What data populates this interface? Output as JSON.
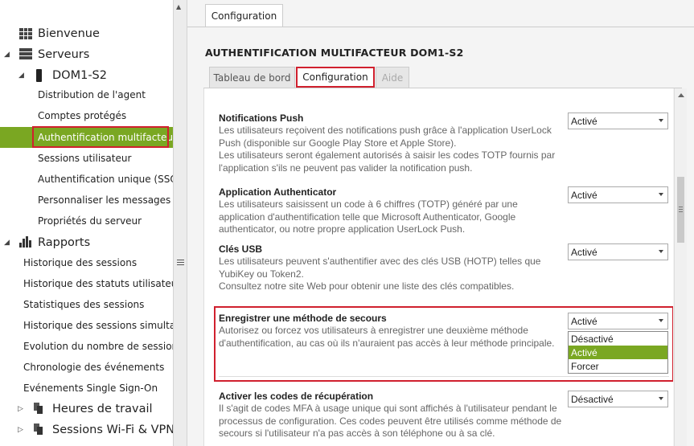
{
  "sidebar": {
    "items": [
      {
        "label": "Bienvenue",
        "icon": "grid-icon"
      },
      {
        "label": "Serveurs",
        "icon": "servers-icon"
      },
      {
        "label": "DOM1-S2",
        "icon": "server-tower-icon"
      },
      {
        "label": "Distribution de l'agent"
      },
      {
        "label": "Comptes protégés"
      },
      {
        "label": "Authentification multifacteur",
        "selected": true
      },
      {
        "label": "Sessions utilisateur"
      },
      {
        "label": "Authentification unique (SSO)"
      },
      {
        "label": "Personnaliser les messages"
      },
      {
        "label": "Propriétés du serveur"
      },
      {
        "label": "Rapports",
        "icon": "bar-chart-icon"
      },
      {
        "label": "Historique des sessions"
      },
      {
        "label": "Historique des statuts utilisateur"
      },
      {
        "label": "Statistiques des sessions"
      },
      {
        "label": "Historique des sessions simultan..."
      },
      {
        "label": "Evolution du nombre de sessions"
      },
      {
        "label": "Chronologie des événements"
      },
      {
        "label": "Evénements Single Sign-On"
      },
      {
        "label": "Heures de travail",
        "icon": "documents-icon"
      },
      {
        "label": "Sessions Wi-Fi & VPN",
        "icon": "documents-icon"
      }
    ]
  },
  "main": {
    "top_tab": "Configuration",
    "page_title": "AUTHENTIFICATION MULTIFACTEUR  DOM1-S2",
    "subtabs": [
      "Tableau de bord",
      "Configuration",
      "Aide"
    ],
    "settings": [
      {
        "title": "Notifications Push",
        "desc": "Les utilisateurs reçoivent des notifications push grâce à l'application UserLock Push (disponible sur Google Play Store et Apple Store).\nLes utilisateurs seront également autorisés à saisir les codes TOTP fournis par l'application s'ils ne peuvent pas valider la notification push.",
        "value": "Activé"
      },
      {
        "title": "Application Authenticator",
        "desc": "Les utilisateurs saisissent un code à 6 chiffres (TOTP) généré par une application d'authentification telle que Microsoft Authenticator, Google authenticator, ou notre propre application UserLock Push.",
        "value": "Activé"
      },
      {
        "title": "Clés USB",
        "desc": "Les utilisateurs peuvent s'authentifier avec des clés USB (HOTP) telles que YubiKey ou Token2.\nConsultez notre site Web pour obtenir une liste des clés compatibles.",
        "value": "Activé"
      },
      {
        "title": "Enregistrer une méthode de secours",
        "desc": "Autorisez ou forcez vos utilisateurs à enregistrer une deuxième méthode d'authentification, au cas où ils n'auraient pas accès à leur méthode principale.",
        "value": "Activé",
        "options": [
          "Désactivé",
          "Activé",
          "Forcer"
        ]
      },
      {
        "title": "Activer les codes de récupération",
        "desc": "Il s'agit de codes MFA à usage unique qui sont affichés à l'utilisateur pendant le processus de configuration. Ces codes peuvent être utilisés comme méthode de secours si l'utilisateur n'a pas accès à son téléphone ou à sa clé.",
        "value": "Désactivé"
      }
    ]
  },
  "colors": {
    "accent_green": "#7aa722",
    "highlight_red": "#d0202e"
  }
}
